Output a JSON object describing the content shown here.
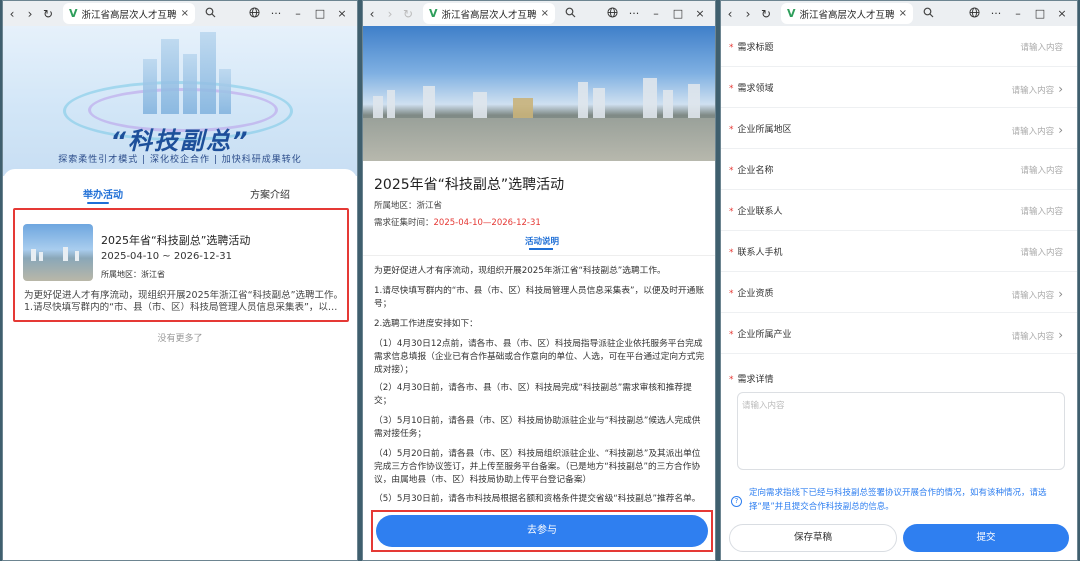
{
  "browser": {
    "tab_title": "浙江省高层次人才互聘共享",
    "tab_close": "×",
    "back": "‹",
    "forward": "›",
    "reload": "↻",
    "search_icon": "search-icon",
    "menu": "···",
    "minimize": "–",
    "maximize": "□",
    "close": "×"
  },
  "window1": {
    "hero_title": "“科技副总”",
    "hero_slogan": "探索柔性引才模式 | 深化校企合作 | 加快科研成果转化",
    "tabs": [
      {
        "label": "举办活动",
        "active": true
      },
      {
        "label": "方案介绍",
        "active": false
      }
    ],
    "activity": {
      "title": "2025年省“科技副总”选聘活动",
      "date_range": "2025-04-10 ~ 2026-12-31",
      "area": "所属地区：浙江省",
      "desc_line1": "为更好促进人才有序流动，现组织开展2025年浙江省“科技副总”选聘工作。",
      "desc_line2": "1.请尽快填写群内的“市、县（市、区）科技局管理人员信息采集表”，以便…"
    },
    "no_more": "没有更多了"
  },
  "window2": {
    "title": "2025年省“科技副总”选聘活动",
    "area": "所属地区：浙江省",
    "period_label": "需求征集时间：",
    "period_value": "2025-04-10—2026-12-31",
    "section_tab": "活动说明",
    "paragraphs": [
      "为更好促进人才有序流动，现组织开展2025年浙江省“科技副总”选聘工作。",
      "1.请尽快填写群内的“市、县（市、区）科技局管理人员信息采集表”，以便及时开通账号；",
      "2.选聘工作进度安排如下：",
      "（1）4月30日12点前，请各市、县（市、区）科技局指导派驻企业依托服务平台完成需求信息填报（企业已有合作基础或合作意向的单位、人选，可在平台通过定向方式完成对接）；",
      "（2）4月30日前，请各市、县（市、区）科技局完成“科技副总”需求审核和推荐提交；",
      "（3）5月10日前，请各县（市、区）科技局协助派驻企业与“科技副总”候选人完成供需对接任务；",
      "（4）5月20日前，请各县（市、区）科技局组织派驻企业、“科技副总”及其派出单位完成三方合作协议签订，并上传至服务平台备案。（已是地方“科技副总”的三方合作协议，由属地县（市、区）科技局协助上传平台登记备案）",
      "（5）5月30日前，请各市科技局根据名额和资格条件提交省级“科技副总”推荐名单。"
    ],
    "join_button": "去参与"
  },
  "window3": {
    "fields": [
      {
        "label": "需求标题",
        "placeholder": "请输入内容",
        "arrow": false
      },
      {
        "label": "需求领域",
        "placeholder": "请输入内容",
        "arrow": true
      },
      {
        "label": "企业所属地区",
        "placeholder": "请输入内容",
        "arrow": true
      },
      {
        "label": "企业名称",
        "placeholder": "请输入内容",
        "arrow": false
      },
      {
        "label": "企业联系人",
        "placeholder": "请输入内容",
        "arrow": false
      },
      {
        "label": "联系人手机",
        "placeholder": "请输入内容",
        "arrow": false
      },
      {
        "label": "企业资质",
        "placeholder": "请输入内容",
        "arrow": true
      },
      {
        "label": "企业所属产业",
        "placeholder": "请输入内容",
        "arrow": true
      }
    ],
    "detail_label": "需求详情",
    "detail_placeholder": "请输入内容",
    "notice": "定向需求指线下已经与科技副总签署协议开展合作的情况，如有该种情况，请选择“是”并且提交合作科技副总的信息。",
    "save_draft": "保存草稿",
    "submit": "提交",
    "arrow_glyph": "›",
    "required_mark": "*"
  },
  "colors": {
    "accent": "#2f7ff0",
    "highlight": "#e53935",
    "brand_green": "#2e9e5b"
  }
}
